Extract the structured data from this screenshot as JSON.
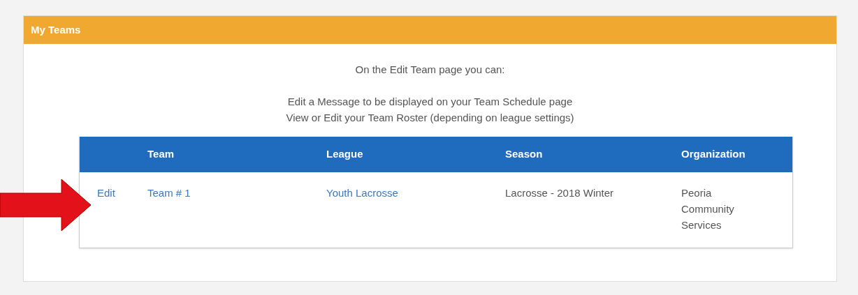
{
  "panel": {
    "title": "My Teams"
  },
  "intro": {
    "heading": "On the Edit Team page you can:",
    "lines": [
      "Edit a Message to be displayed on your Team Schedule page",
      "View or Edit your Team Roster (depending on league settings)"
    ]
  },
  "table": {
    "columns": [
      "",
      "Team",
      "League",
      "Season",
      "Organization"
    ],
    "rows": [
      {
        "action": "Edit",
        "team": "Team # 1",
        "league": "Youth Lacrosse",
        "season": "Lacrosse - 2018 Winter",
        "organization": "Peoria Community Services"
      }
    ]
  },
  "annotation": {
    "kind": "arrow"
  }
}
